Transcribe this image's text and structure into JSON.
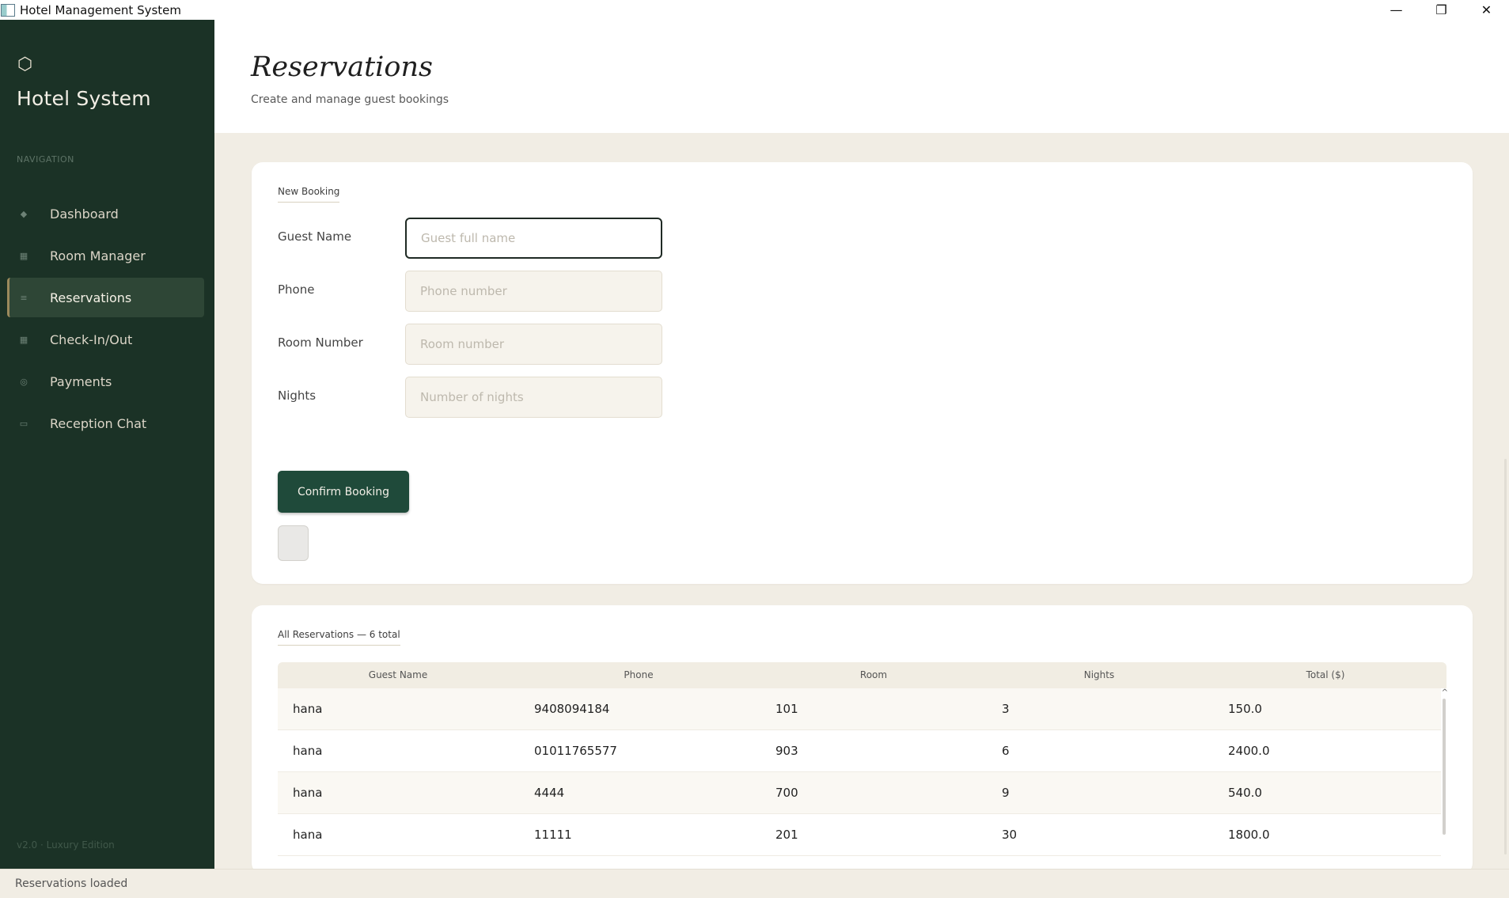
{
  "window": {
    "title": "Hotel Management System",
    "controls": {
      "minimize": "—",
      "restore": "❐",
      "close": "✕"
    }
  },
  "sidebar": {
    "brand_icon": "⬡",
    "brand_name": "Hotel System",
    "nav_heading": "NAVIGATION",
    "items": [
      {
        "label": "Dashboard",
        "icon": "◆",
        "icon_name": "dashboard-icon",
        "active": false
      },
      {
        "label": "Room Manager",
        "icon": "▦",
        "icon_name": "room-icon",
        "active": false
      },
      {
        "label": "Reservations",
        "icon": "≡",
        "icon_name": "reservations-icon",
        "active": true
      },
      {
        "label": "Check-In/Out",
        "icon": "▦",
        "icon_name": "checkin-icon",
        "active": false
      },
      {
        "label": "Payments",
        "icon": "◎",
        "icon_name": "payments-icon",
        "active": false
      },
      {
        "label": "Reception Chat",
        "icon": "▭",
        "icon_name": "chat-icon",
        "active": false
      }
    ],
    "version": "v2.0  ·  Luxury Edition"
  },
  "header": {
    "title": "Reservations",
    "subtitle": "Create and manage guest bookings"
  },
  "booking_form": {
    "section_label": "New Booking",
    "fields": [
      {
        "label": "Guest Name",
        "placeholder": "Guest full name",
        "value": ""
      },
      {
        "label": "Phone",
        "placeholder": "Phone number",
        "value": ""
      },
      {
        "label": "Room Number",
        "placeholder": "Room number",
        "value": ""
      },
      {
        "label": "Nights",
        "placeholder": "Number of nights",
        "value": ""
      }
    ],
    "confirm_label": "Confirm Booking"
  },
  "reservations": {
    "section_label": "All Reservations — 6 total",
    "columns": [
      "Guest Name",
      "Phone",
      "Room",
      "Nights",
      "Total ($)"
    ],
    "rows": [
      [
        "hana",
        "9408094184",
        "101",
        "3",
        "150.0"
      ],
      [
        "hana",
        "01011765577",
        "903",
        "6",
        "2400.0"
      ],
      [
        "hana",
        "4444",
        "700",
        "9",
        "540.0"
      ],
      [
        "hana",
        "11111",
        "201",
        "30",
        "1800.0"
      ]
    ]
  },
  "statusbar": {
    "text": "Reservations loaded"
  },
  "colors": {
    "sidebar_bg": "#1b3226",
    "accent": "#1f4a3a",
    "page_bg": "#f1ede4",
    "active_border": "#9c8a5c"
  }
}
